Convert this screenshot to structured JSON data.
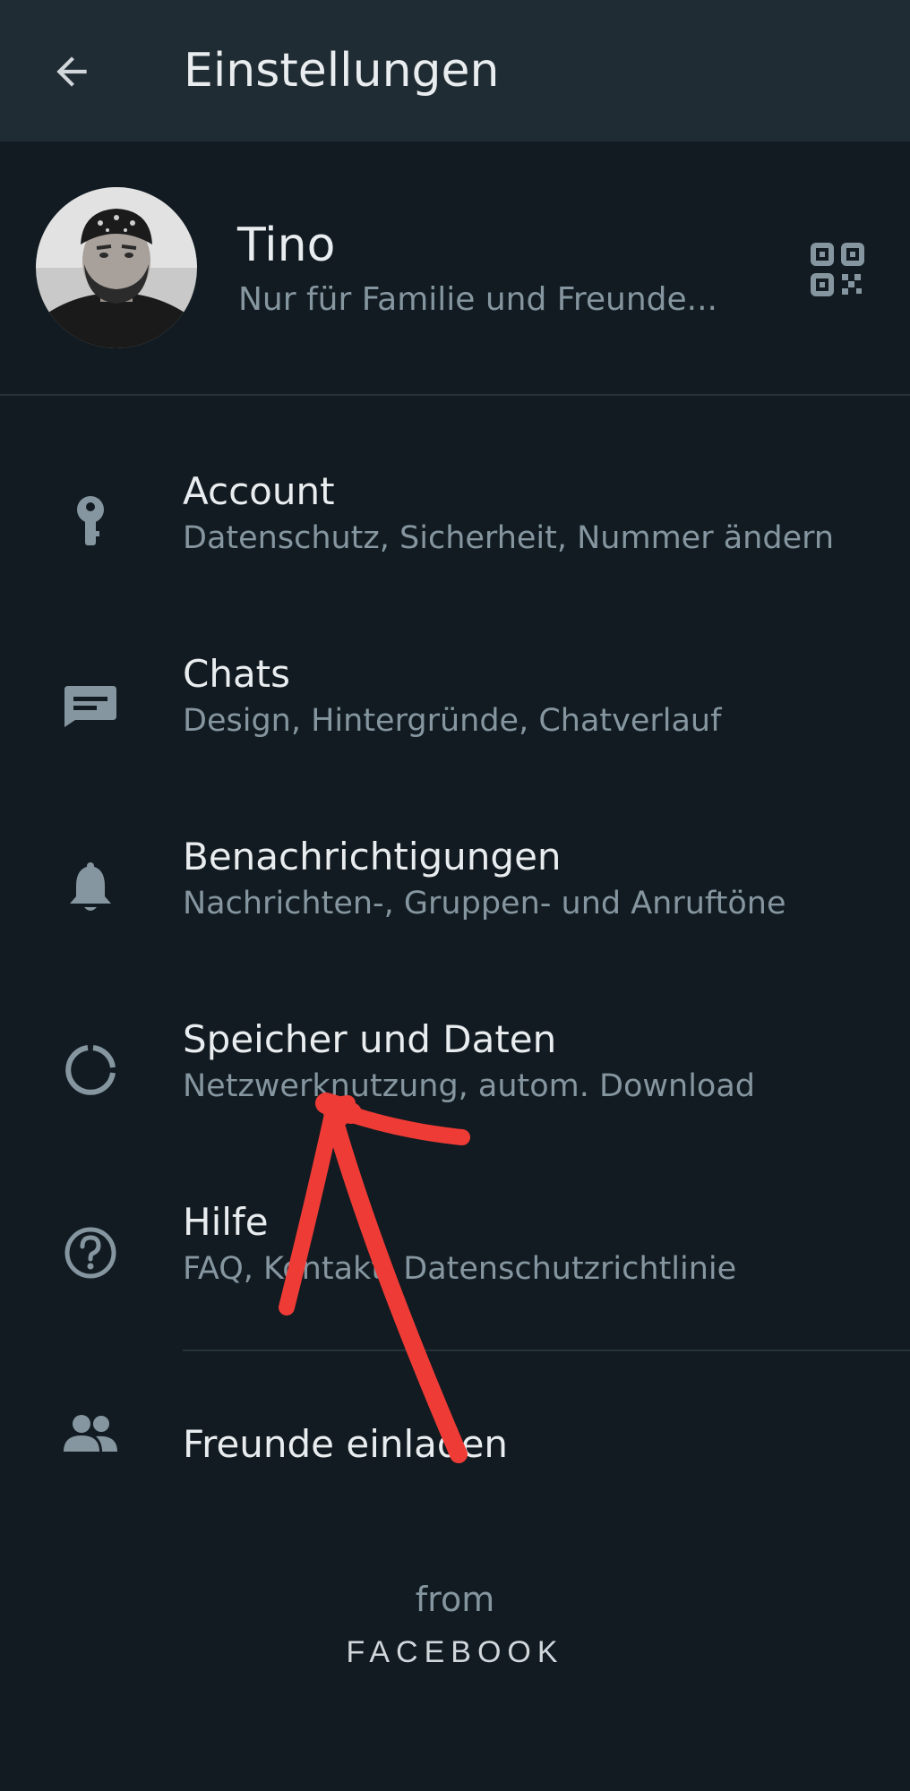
{
  "appbar": {
    "title": "Einstellungen",
    "back_icon": "arrow-left-icon"
  },
  "profile": {
    "name": "Tino",
    "status": "Nur für Familie und Freunde...",
    "qr_icon": "qr-code-icon"
  },
  "settings": [
    {
      "title": "Account",
      "subtitle": "Datenschutz, Sicherheit, Nummer ändern",
      "icon": "key-icon"
    },
    {
      "title": "Chats",
      "subtitle": "Design, Hintergründe, Chatverlauf",
      "icon": "chat-icon"
    },
    {
      "title": "Benachrichtigungen",
      "subtitle": "Nachrichten-, Gruppen- und Anruftöne",
      "icon": "bell-icon"
    },
    {
      "title": "Speicher und Daten",
      "subtitle": "Netzwerknutzung, autom. Download",
      "icon": "data-usage-icon"
    },
    {
      "title": "Hilfe",
      "subtitle": "FAQ, Kontakt, Datenschutzrichtlinie",
      "icon": "help-icon"
    }
  ],
  "invite": {
    "title": "Freunde einladen",
    "icon": "people-icon"
  },
  "footer": {
    "from": "from",
    "brand": "FACEBOOK"
  },
  "colors": {
    "background": "#111b21",
    "appbar": "#202c33",
    "primary_text": "#e9edef",
    "secondary_text": "#8696a0",
    "icon": "#8696a0",
    "annotation_arrow": "#ef3b36"
  }
}
